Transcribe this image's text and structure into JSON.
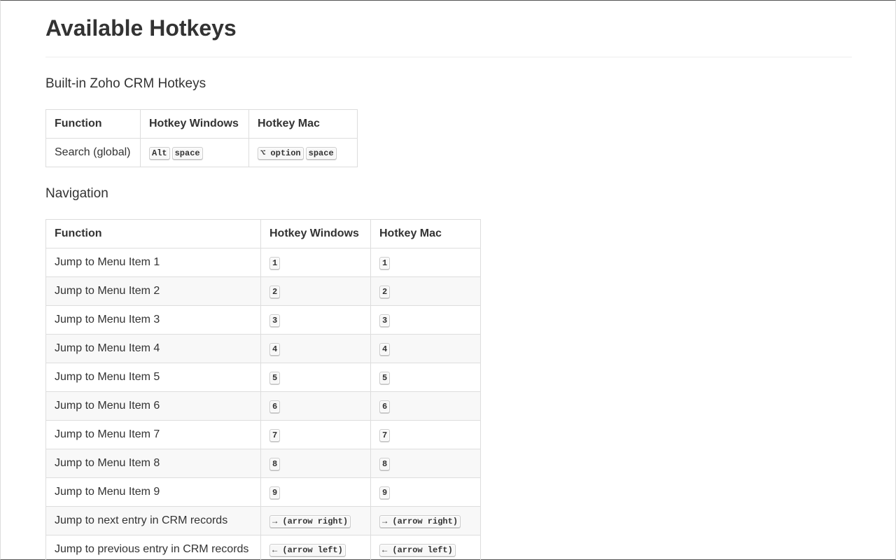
{
  "page_title": "Available Hotkeys",
  "sections": {
    "builtin": {
      "heading": "Built-in Zoho CRM Hotkeys",
      "headers": [
        "Function",
        "Hotkey Windows",
        "Hotkey Mac"
      ],
      "rows": [
        {
          "function": "Search (global)",
          "win": [
            "Alt",
            "space"
          ],
          "mac": [
            "⌥ option",
            "space"
          ]
        }
      ]
    },
    "navigation": {
      "heading": "Navigation",
      "headers": [
        "Function",
        "Hotkey Windows",
        "Hotkey Mac"
      ],
      "rows": [
        {
          "function": "Jump to Menu Item 1",
          "win": [
            "1"
          ],
          "mac": [
            "1"
          ]
        },
        {
          "function": "Jump to Menu Item 2",
          "win": [
            "2"
          ],
          "mac": [
            "2"
          ]
        },
        {
          "function": "Jump to Menu Item 3",
          "win": [
            "3"
          ],
          "mac": [
            "3"
          ]
        },
        {
          "function": "Jump to Menu Item 4",
          "win": [
            "4"
          ],
          "mac": [
            "4"
          ]
        },
        {
          "function": "Jump to Menu Item 5",
          "win": [
            "5"
          ],
          "mac": [
            "5"
          ]
        },
        {
          "function": "Jump to Menu Item 6",
          "win": [
            "6"
          ],
          "mac": [
            "6"
          ]
        },
        {
          "function": "Jump to Menu Item 7",
          "win": [
            "7"
          ],
          "mac": [
            "7"
          ]
        },
        {
          "function": "Jump to Menu Item 8",
          "win": [
            "8"
          ],
          "mac": [
            "8"
          ]
        },
        {
          "function": "Jump to Menu Item 9",
          "win": [
            "9"
          ],
          "mac": [
            "9"
          ]
        },
        {
          "function": "Jump to next entry in CRM records",
          "win": [
            "→ (arrow right)"
          ],
          "mac": [
            "→ (arrow right)"
          ]
        },
        {
          "function": "Jump to previous entry in CRM records",
          "win": [
            "← (arrow left)"
          ],
          "mac": [
            "← (arrow left)"
          ]
        }
      ]
    }
  }
}
